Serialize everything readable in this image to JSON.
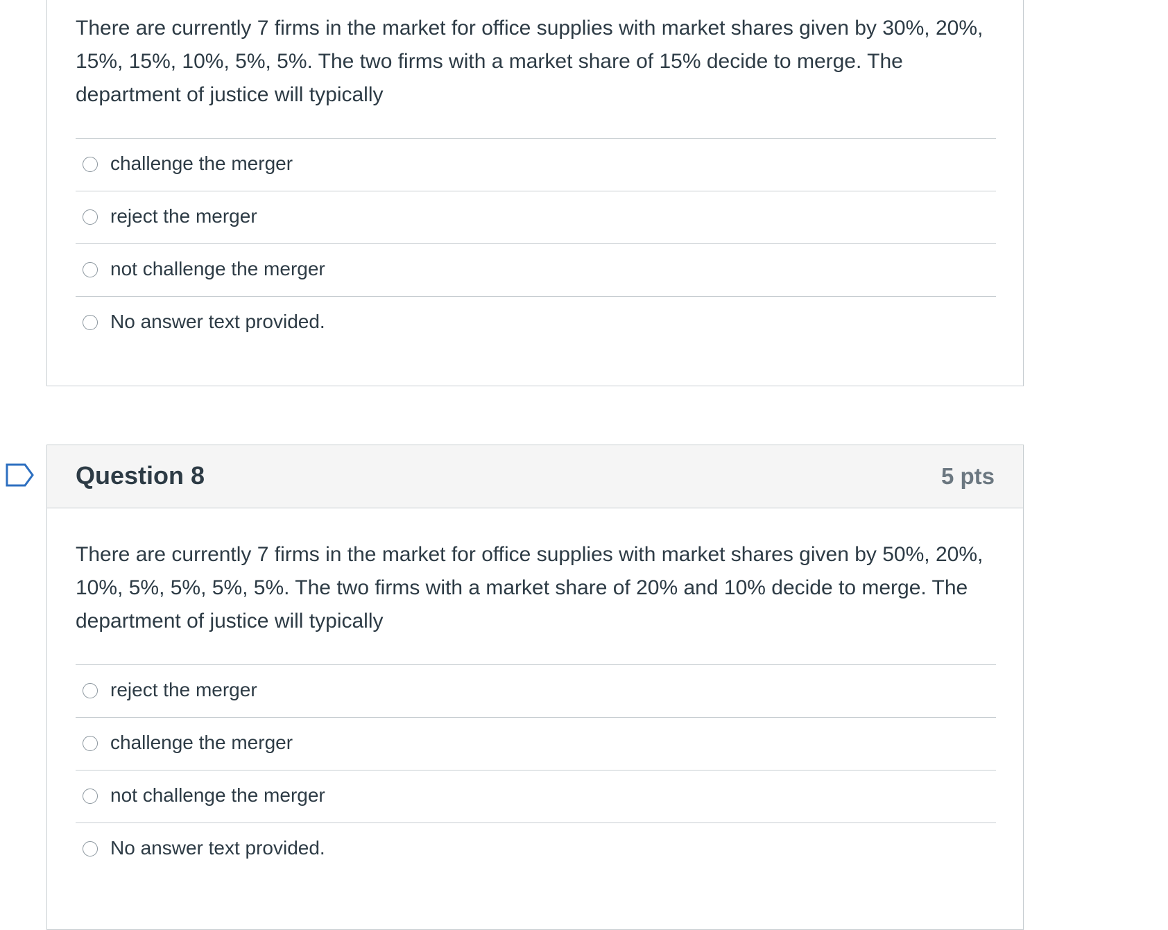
{
  "previous_question": {
    "text": "There are currently 7 firms in the market for office supplies with market shares given by 30%, 20%, 15%, 15%, 10%, 5%, 5%. The two firms with a market share of 15% decide to merge. The department of justice will typically",
    "answers": [
      {
        "label": "challenge the merger"
      },
      {
        "label": "reject the merger"
      },
      {
        "label": "not challenge the merger"
      },
      {
        "label": "No answer text provided."
      }
    ]
  },
  "question_8": {
    "title": "Question 8",
    "points": "5 pts",
    "text": "There are currently 7 firms in the market for office supplies with market shares given by 50%, 20%, 10%, 5%, 5%, 5%, 5%. The two firms with a market share of 20% and 10% decide to merge. The department of justice will typically",
    "answers": [
      {
        "label": "reject the merger"
      },
      {
        "label": "challenge the merger"
      },
      {
        "label": "not challenge the merger"
      },
      {
        "label": "No answer text provided."
      }
    ]
  },
  "icons": {
    "flag": "flag-question-icon",
    "radio": "radio-unchecked-icon"
  },
  "colors": {
    "flag_outline": "#2d6fc0",
    "header_bg": "#f5f5f5",
    "border": "#c7cdd1",
    "text": "#2d3b45",
    "points": "#6b7780"
  }
}
